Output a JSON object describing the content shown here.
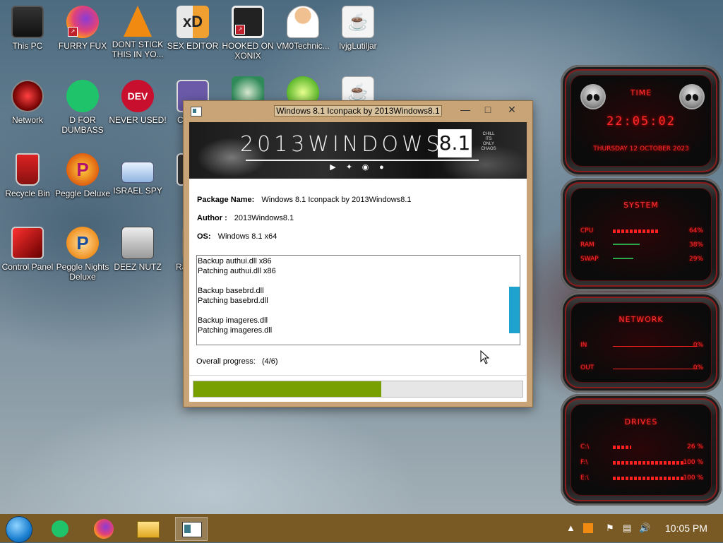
{
  "desktop": {
    "icons": [
      {
        "label": "This PC"
      },
      {
        "label": "FURRY FUX"
      },
      {
        "label": "DONT STICK THIS IN YO..."
      },
      {
        "label": "SEX EDITOR"
      },
      {
        "label": "HOOKED ON XONIX"
      },
      {
        "label": "VM0Technic..."
      },
      {
        "label": "lvjgLutiljar"
      },
      {
        "label": "Network"
      },
      {
        "label": "D FOR DUMBASS"
      },
      {
        "label": "NEVER USED!"
      },
      {
        "label": "CRE CL"
      },
      {
        "label": "Recycle Bin"
      },
      {
        "label": "Peggle Deluxe"
      },
      {
        "label": "ISRAEL SPY"
      },
      {
        "label": "2PA"
      },
      {
        "label": "Control Panel"
      },
      {
        "label": "Peggle Nights Deluxe"
      },
      {
        "label": "DEEZ NUTZ"
      },
      {
        "label": "Ran Mak"
      }
    ]
  },
  "window": {
    "title": "Windows 8.1 Iconpack by 2013Windows8.1",
    "minimize": "—",
    "maximize": "□",
    "close": "✕",
    "banner": {
      "brand": "2013WINDOWS",
      "version": "8.1",
      "small_text": "CHILL ITS ONLY CHAOS",
      "social_icons": [
        "youtube-icon",
        "twitter-icon",
        "instagram-icon",
        "github-icon"
      ]
    },
    "package_label": "Package Name:",
    "package_value": "Windows 8.1 Iconpack by 2013Windows8.1",
    "author_label": "Author :",
    "author_value": "2013Windows8.1",
    "os_label": "OS:",
    "os_value": "Windows 8.1 x64",
    "log_lines": [
      "Backup authui.dll x86",
      "Patching authui.dll x86",
      "",
      "Backup basebrd.dll",
      "Patching basebrd.dll",
      "",
      "Backup imageres.dll",
      "Patching imageres.dll"
    ],
    "overall_label": "Overall progress:",
    "overall_value": "(4/6)",
    "progress_fraction": 0.57
  },
  "gadget": {
    "time_title": "TIME",
    "time": "22:05:02",
    "date": "THURSDAY 12 OCTOBER 2023",
    "system_title": "SYSTEM",
    "cpu_label": "CPU",
    "cpu_value": "64%",
    "cpu_fraction": 0.64,
    "ram_label": "RAM",
    "ram_value": "38%",
    "ram_fraction": 0.38,
    "swap_label": "SWAP",
    "swap_value": "29%",
    "swap_fraction": 0.29,
    "network_title": "NETWORK",
    "in_label": "IN",
    "in_value": "0%",
    "out_label": "OUT",
    "out_value": "0%",
    "drives_title": "DRIVES",
    "c_label": "C:\\",
    "c_value": "26 %",
    "c_fraction": 0.26,
    "f_label": "F:\\",
    "f_value": "100 %",
    "f_fraction": 1.0,
    "e_label": "E:\\",
    "e_value": "100 %",
    "e_fraction": 1.0
  },
  "taskbar": {
    "clock": "10:05 PM",
    "accent": "#7a5a24",
    "pinned": [
      "start-orb-icon",
      "notes-app-icon",
      "firefox-icon",
      "file-explorer-icon",
      "installer-app-icon"
    ]
  }
}
